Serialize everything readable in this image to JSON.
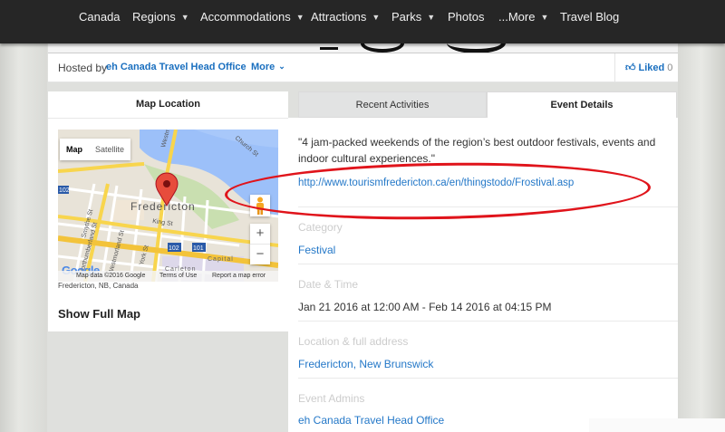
{
  "nav": {
    "items": [
      {
        "label": "Canada",
        "dropdown": false
      },
      {
        "label": "Regions",
        "dropdown": true
      },
      {
        "label": "Accommodations",
        "dropdown": true
      },
      {
        "label": "Attractions",
        "dropdown": true
      },
      {
        "label": "Parks",
        "dropdown": true
      },
      {
        "label": "Photos",
        "dropdown": false
      },
      {
        "label": "...More",
        "dropdown": true
      },
      {
        "label": "Travel Blog",
        "dropdown": false
      }
    ]
  },
  "host": {
    "prefix": "Hosted by",
    "name": "eh Canada Travel Head Office",
    "more_label": "More",
    "liked_label": "Liked",
    "liked_count": "0"
  },
  "map": {
    "header": "Map Location",
    "type_map": "Map",
    "type_satellite": "Satellite",
    "city_label": "Fredericton",
    "streets": [
      "Westmorland St",
      "Smythe St",
      "Northumberland St",
      "Westmorland St",
      "King St",
      "York St",
      "Church St",
      "Carleton",
      "Capital"
    ],
    "route_labels": [
      "102",
      "102",
      "101"
    ],
    "google_logo": "Google",
    "attribution_data": "Map data ©2016 Google",
    "attribution_terms": "Terms of Use",
    "attribution_report": "Report a map error",
    "caption": "Fredericton, NB, Canada",
    "full_map_label": "Show Full Map",
    "zoom_in": "+",
    "zoom_out": "−"
  },
  "tabs": {
    "recent": "Recent Activities",
    "details": "Event Details"
  },
  "event": {
    "description": "\"4 jam-packed weekends of the region’s best outdoor festivals, events and indoor cultural experiences.\"",
    "url": "http://www.tourismfredericton.ca/en/thingstodo/Frostival.asp",
    "category_label": "Category",
    "category_value": "Festival",
    "date_label": "Date & Time",
    "date_value": "Jan 21 2016 at 12:00 AM - Feb 14 2016 at 04:15 PM",
    "location_label": "Location & full address",
    "location_value": "Fredericton, New Brunswick",
    "admin_label": "Event Admins",
    "admin_value": "eh Canada Travel Head Office"
  },
  "colors": {
    "nav_bg": "#262626",
    "link": "#2478c8",
    "highlight": "#e0141b"
  }
}
